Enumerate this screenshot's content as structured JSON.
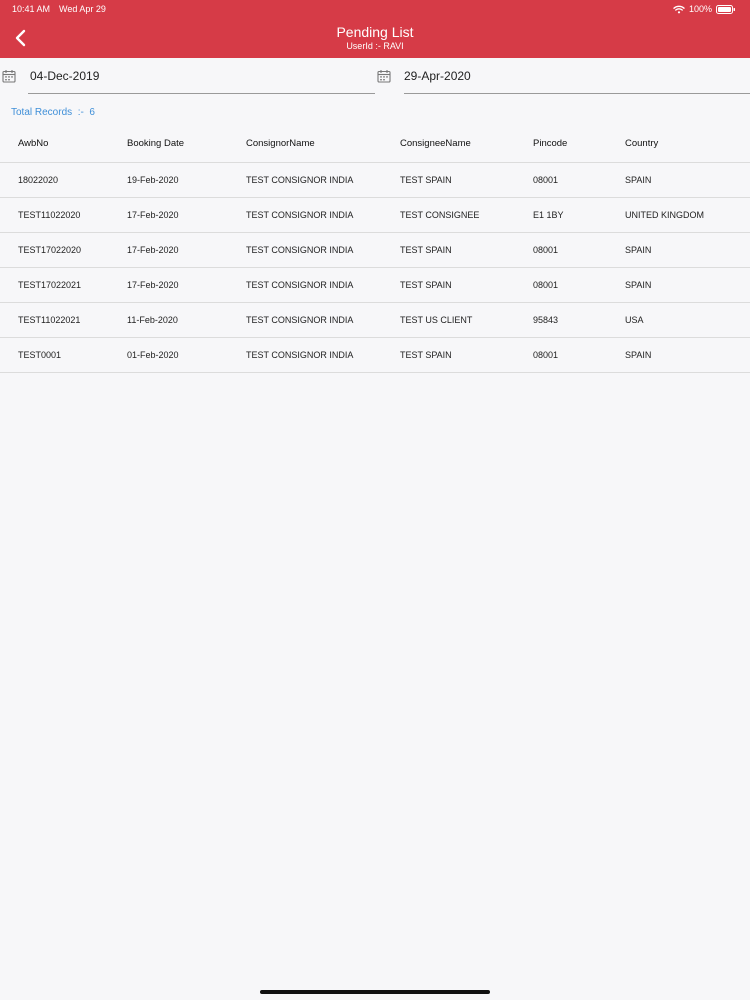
{
  "status_bar": {
    "time": "10:41 AM",
    "date": "Wed Apr 29",
    "battery": "100%"
  },
  "header": {
    "title": "Pending List",
    "userid_label": "UserId :-",
    "userid_value": "RAVI"
  },
  "filters": {
    "from_date": "04-Dec-2019",
    "to_date": "29-Apr-2020"
  },
  "summary": {
    "total_label": "Total Records",
    "separator": ":-",
    "total_value": "6"
  },
  "table": {
    "columns": [
      "AwbNo",
      "Booking Date",
      "ConsignorName",
      "ConsigneeName",
      "Pincode",
      "Country"
    ],
    "rows": [
      [
        "18022020",
        "19-Feb-2020",
        "TEST CONSIGNOR INDIA",
        "TEST SPAIN",
        "08001",
        "SPAIN"
      ],
      [
        "TEST11022020",
        "17-Feb-2020",
        "TEST CONSIGNOR INDIA",
        "TEST CONSIGNEE",
        "E1 1BY",
        "UNITED KINGDOM"
      ],
      [
        "TEST17022020",
        "17-Feb-2020",
        "TEST CONSIGNOR INDIA",
        "TEST SPAIN",
        "08001",
        "SPAIN"
      ],
      [
        "TEST17022021",
        "17-Feb-2020",
        "TEST CONSIGNOR INDIA",
        "TEST SPAIN",
        "08001",
        "SPAIN"
      ],
      [
        "TEST11022021",
        "11-Feb-2020",
        "TEST CONSIGNOR INDIA",
        "TEST US CLIENT",
        "95843",
        "USA"
      ],
      [
        "TEST0001",
        "01-Feb-2020",
        "TEST CONSIGNOR INDIA",
        "TEST SPAIN",
        "08001",
        "SPAIN"
      ]
    ]
  },
  "colors": {
    "header_bg": "#d63b47",
    "accent_link": "#3f8fd8"
  },
  "icons": {
    "back": "chevron-left-icon",
    "calendar": "calendar-icon",
    "wifi": "wifi-icon",
    "battery": "battery-icon"
  }
}
